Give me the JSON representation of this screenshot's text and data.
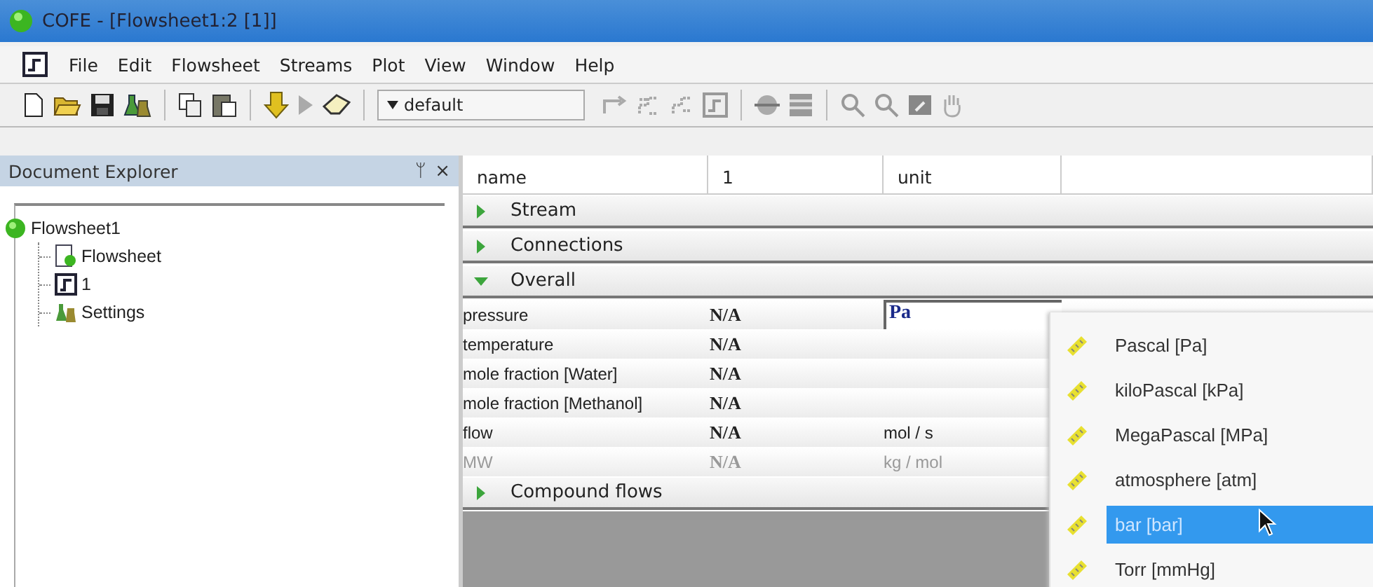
{
  "window": {
    "title": "COFE - [Flowsheet1:2 [1]]"
  },
  "menu": [
    "File",
    "Edit",
    "Flowsheet",
    "Streams",
    "Plot",
    "View",
    "Window",
    "Help"
  ],
  "toolbar": {
    "preset": "default"
  },
  "explorer": {
    "title": "Document Explorer",
    "pin": "ᛘ",
    "close": "×",
    "tree": [
      {
        "label": "Flowsheet1",
        "kind": "root",
        "children": [
          {
            "label": "Flowsheet",
            "kind": "flowsheet"
          },
          {
            "label": "1",
            "kind": "unit"
          },
          {
            "label": "Settings",
            "kind": "settings"
          }
        ]
      }
    ]
  },
  "table": {
    "columns": [
      "name",
      "1",
      "unit"
    ],
    "sections": [
      {
        "label": "Stream",
        "expanded": false
      },
      {
        "label": "Connections",
        "expanded": false
      },
      {
        "label": "Overall",
        "expanded": true,
        "rows": [
          {
            "name": "pressure",
            "value": "N/A",
            "unit": "Pa",
            "editing": true,
            "disabled": false
          },
          {
            "name": "temperature",
            "value": "N/A",
            "editing": false,
            "disabled": false
          },
          {
            "name": "mole fraction [Water]",
            "value": "N/A",
            "editing": false,
            "disabled": false
          },
          {
            "name": "mole fraction [Methanol]",
            "value": "N/A",
            "editing": false,
            "disabled": false
          },
          {
            "name": "flow",
            "value": "N/A",
            "unit": "mol / s",
            "editing": false,
            "disabled": false
          },
          {
            "name": "MW",
            "value": "N/A",
            "unit": "kg / mol",
            "editing": false,
            "disabled": true
          }
        ]
      },
      {
        "label": "Compound flows",
        "expanded": false
      }
    ]
  },
  "unit_menu": {
    "items": [
      {
        "label": "Pascal [Pa]",
        "selected": false
      },
      {
        "label": "kiloPascal [kPa]",
        "selected": false
      },
      {
        "label": "MegaPascal [MPa]",
        "selected": false
      },
      {
        "label": "atmosphere [atm]",
        "selected": false
      },
      {
        "label": "bar [bar]",
        "selected": true
      },
      {
        "label": "Torr [mmHg]",
        "selected": false
      }
    ]
  }
}
